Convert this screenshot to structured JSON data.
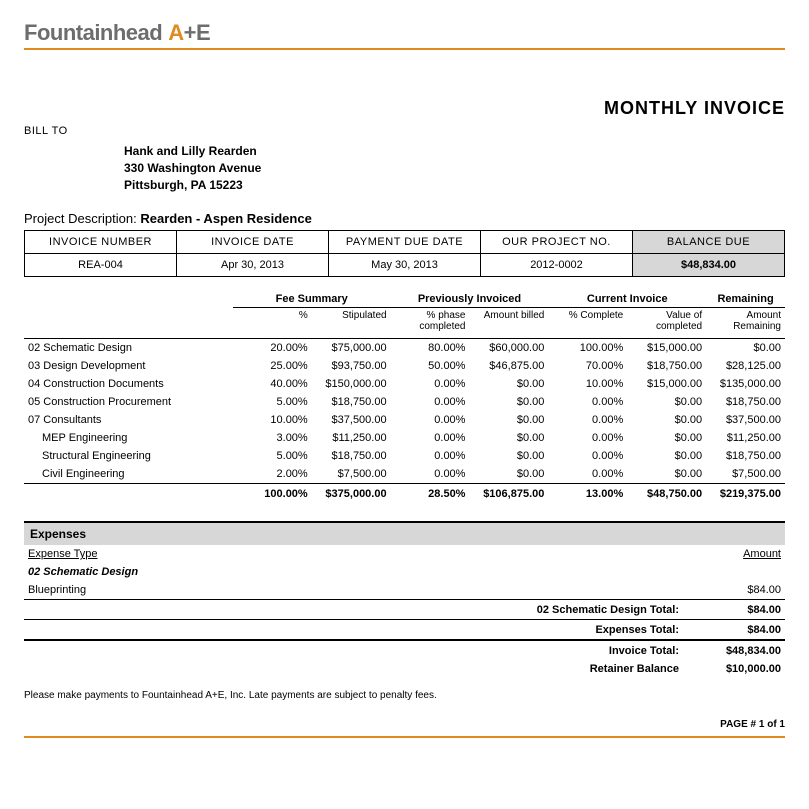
{
  "company": {
    "name": "Fountainhead",
    "a": "A",
    "plus": "+",
    "e": "E"
  },
  "doc_title": "MONTHLY INVOICE",
  "bill_to_label": "BILL TO",
  "bill_to": {
    "name": "Hank and Lilly Rearden",
    "street": "330 Washington Avenue",
    "city_line": "Pittsburgh,  PA  15223"
  },
  "project_desc": {
    "label": "Project Description:",
    "value": "Rearden - Aspen Residence"
  },
  "meta": {
    "headers": {
      "invoice_number": "INVOICE NUMBER",
      "invoice_date": "INVOICE DATE",
      "payment_due": "PAYMENT DUE DATE",
      "project_no": "OUR PROJECT NO.",
      "balance_due": "BALANCE DUE"
    },
    "values": {
      "invoice_number": "REA-004",
      "invoice_date": "Apr 30, 2013",
      "payment_due": "May 30, 2013",
      "project_no": "2012-0002",
      "balance_due": "$48,834.00"
    }
  },
  "fee_groups": {
    "fee_summary": "Fee Summary",
    "previously": "Previously Invoiced",
    "current": "Current Invoice",
    "remaining": "Remaining"
  },
  "fee_sub": {
    "pct": "%",
    "stipulated": "Stipulated",
    "phase_complete": "% phase completed",
    "amount_billed": "Amount billed",
    "pct_complete": "% Complete",
    "value_completed": "Value of completed",
    "amount_remaining": "Amount Remaining"
  },
  "fee_rows": [
    {
      "name": "02 Schematic Design",
      "indent": false,
      "pct": "20.00%",
      "stip": "$75,000.00",
      "phc": "80.00%",
      "amt": "$60,000.00",
      "cpc": "100.00%",
      "val": "$15,000.00",
      "rem": "$0.00"
    },
    {
      "name": "03 Design Development",
      "indent": false,
      "pct": "25.00%",
      "stip": "$93,750.00",
      "phc": "50.00%",
      "amt": "$46,875.00",
      "cpc": "70.00%",
      "val": "$18,750.00",
      "rem": "$28,125.00"
    },
    {
      "name": "04 Construction Documents",
      "indent": false,
      "pct": "40.00%",
      "stip": "$150,000.00",
      "phc": "0.00%",
      "amt": "$0.00",
      "cpc": "10.00%",
      "val": "$15,000.00",
      "rem": "$135,000.00"
    },
    {
      "name": "05 Construction Procurement",
      "indent": false,
      "pct": "5.00%",
      "stip": "$18,750.00",
      "phc": "0.00%",
      "amt": "$0.00",
      "cpc": "0.00%",
      "val": "$0.00",
      "rem": "$18,750.00"
    },
    {
      "name": "07 Consultants",
      "indent": false,
      "pct": "10.00%",
      "stip": "$37,500.00",
      "phc": "0.00%",
      "amt": "$0.00",
      "cpc": "0.00%",
      "val": "$0.00",
      "rem": "$37,500.00"
    },
    {
      "name": "MEP Engineering",
      "indent": true,
      "pct": "3.00%",
      "stip": "$11,250.00",
      "phc": "0.00%",
      "amt": "$0.00",
      "cpc": "0.00%",
      "val": "$0.00",
      "rem": "$11,250.00"
    },
    {
      "name": "Structural Engineering",
      "indent": true,
      "pct": "5.00%",
      "stip": "$18,750.00",
      "phc": "0.00%",
      "amt": "$0.00",
      "cpc": "0.00%",
      "val": "$0.00",
      "rem": "$18,750.00"
    },
    {
      "name": "Civil Engineering",
      "indent": true,
      "pct": "2.00%",
      "stip": "$7,500.00",
      "phc": "0.00%",
      "amt": "$0.00",
      "cpc": "0.00%",
      "val": "$0.00",
      "rem": "$7,500.00"
    }
  ],
  "fee_totals": {
    "name": "",
    "pct": "100.00%",
    "stip": "$375,000.00",
    "phc": "28.50%",
    "amt": "$106,875.00",
    "cpc": "13.00%",
    "val": "$48,750.00",
    "rem": "$219,375.00"
  },
  "expenses": {
    "header": "Expenses",
    "type_label": "Expense Type",
    "amount_label": "Amount",
    "category": "02 Schematic Design",
    "item": {
      "name": "Blueprinting",
      "amount": "$84.00"
    },
    "cat_total_label": "02 Schematic Design Total:",
    "cat_total": "$84.00",
    "total_label": "Expenses Total:",
    "total": "$84.00"
  },
  "summary": {
    "invoice_total_label": "Invoice Total:",
    "invoice_total": "$48,834.00",
    "retainer_label": "Retainer Balance",
    "retainer": "$10,000.00"
  },
  "footnote": "Please make payments to Fountainhead A+E, Inc. Late payments are subject to penalty fees.",
  "page_no": "PAGE # 1 of 1"
}
